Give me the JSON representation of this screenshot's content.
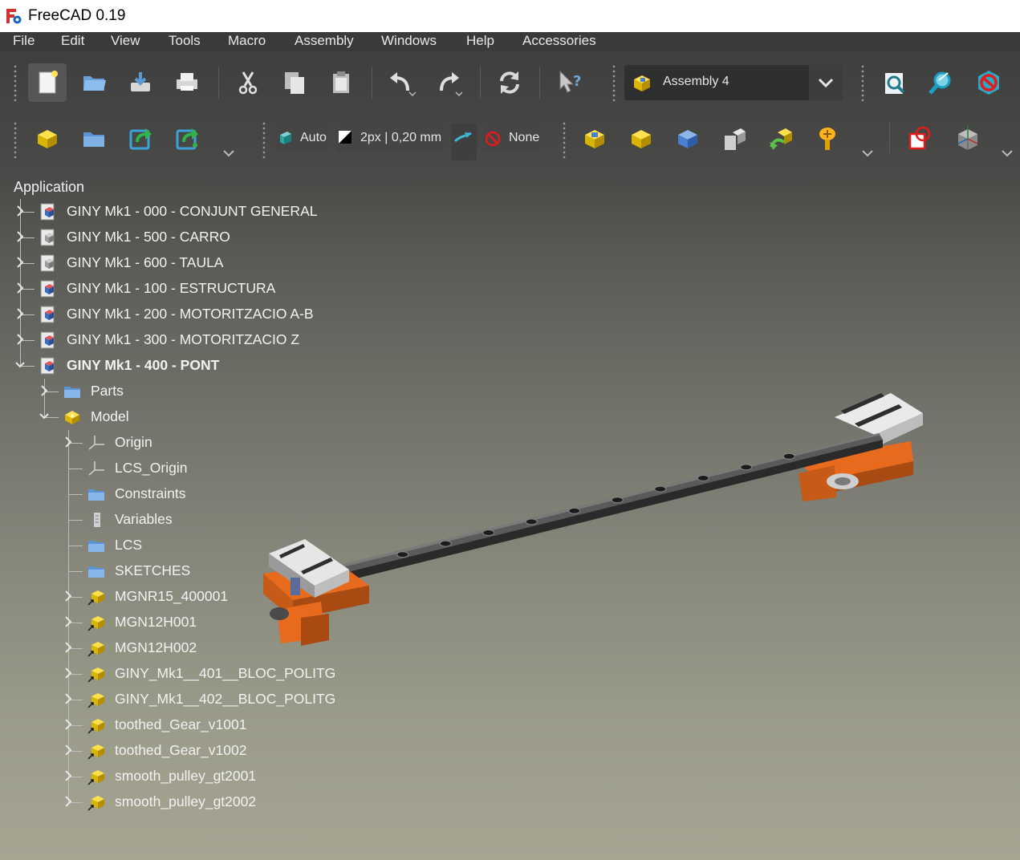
{
  "window": {
    "title": "FreeCAD 0.19"
  },
  "menu": [
    {
      "label": "File"
    },
    {
      "label": "Edit"
    },
    {
      "label": "View"
    },
    {
      "label": "Tools"
    },
    {
      "label": "Macro"
    },
    {
      "label": "Assembly"
    },
    {
      "label": "Windows"
    },
    {
      "label": "Help"
    },
    {
      "label": "Accessories"
    }
  ],
  "toolbar": {
    "workbench": "Assembly 4",
    "draw_style": "Auto",
    "line_width": "2px | 0,20 mm",
    "selection_filter": "None",
    "icons_row1": [
      "new-document-icon",
      "open-folder-icon",
      "save-icon",
      "print-icon",
      "cut-icon",
      "copy-icon",
      "paste-icon",
      "undo-icon",
      "redo-icon",
      "refresh-icon",
      "whats-this-icon",
      "zoom-fit-icon",
      "zoom-selection-icon",
      "no-clipping-icon"
    ],
    "icons_row2": [
      "new-model-icon",
      "new-group-icon",
      "import-icon",
      "export-icon",
      "draw-style-icon",
      "line-width-icon",
      "measure-icon",
      "selection-filter-icon",
      "asm-part-icon",
      "asm-body-icon",
      "asm-link-icon",
      "asm-datum-icon",
      "asm-move-icon",
      "asm-fastener-icon",
      "asm-select-icon",
      "asm-view-icon"
    ]
  },
  "colors": {
    "accent_orange": "#e86b1d",
    "rail": "#3c3c3c",
    "carriage": "#d9d9d9"
  },
  "tree": {
    "header": "Application",
    "rows": [
      {
        "label": "GINY Mk1 - 000 - CONJUNT GENERAL",
        "icon": "document-icon",
        "expanded": false
      },
      {
        "label": "GINY Mk1 - 500 - CARRO",
        "icon": "document-grey-icon",
        "expanded": false
      },
      {
        "label": "GINY Mk1 - 600 - TAULA",
        "icon": "document-grey-icon",
        "expanded": false
      },
      {
        "label": "GINY Mk1 - 100 - ESTRUCTURA",
        "icon": "document-icon",
        "expanded": false
      },
      {
        "label": "GINY Mk1 - 200 - MOTORITZACIO A-B",
        "icon": "document-icon",
        "expanded": false
      },
      {
        "label": "GINY Mk1 - 300 - MOTORITZACIO Z",
        "icon": "document-icon",
        "expanded": false
      },
      {
        "label": "GINY Mk1 - 400 - PONT",
        "icon": "document-icon",
        "expanded": true,
        "bold": true
      },
      {
        "label": "Parts",
        "icon": "folder-icon",
        "expanded": false
      },
      {
        "label": "Model",
        "icon": "model-icon",
        "expanded": true
      },
      {
        "label": "Origin",
        "icon": "origin-icon",
        "expanded": false
      },
      {
        "label": "LCS_Origin",
        "icon": "lcs-icon"
      },
      {
        "label": "Constraints",
        "icon": "folder-icon"
      },
      {
        "label": "Variables",
        "icon": "variables-icon"
      },
      {
        "label": "LCS",
        "icon": "folder-icon"
      },
      {
        "label": "SKETCHES",
        "icon": "folder-icon"
      },
      {
        "label": "MGNR15_400001",
        "icon": "link-part-icon",
        "expanded": false
      },
      {
        "label": "MGN12H001",
        "icon": "link-part-icon",
        "expanded": false
      },
      {
        "label": "MGN12H002",
        "icon": "link-part-icon",
        "expanded": false
      },
      {
        "label": "GINY_Mk1__401__BLOC_POLITG",
        "icon": "link-part-icon",
        "expanded": false
      },
      {
        "label": "GINY_Mk1__402__BLOC_POLITG",
        "icon": "link-part-icon",
        "expanded": false
      },
      {
        "label": "toothed_Gear_v1001",
        "icon": "link-part-icon",
        "expanded": false
      },
      {
        "label": "toothed_Gear_v1002",
        "icon": "link-part-icon",
        "expanded": false
      },
      {
        "label": "smooth_pulley_gt2001",
        "icon": "link-part-icon",
        "expanded": false
      },
      {
        "label": "smooth_pulley_gt2002",
        "icon": "link-part-icon",
        "expanded": false
      }
    ]
  }
}
